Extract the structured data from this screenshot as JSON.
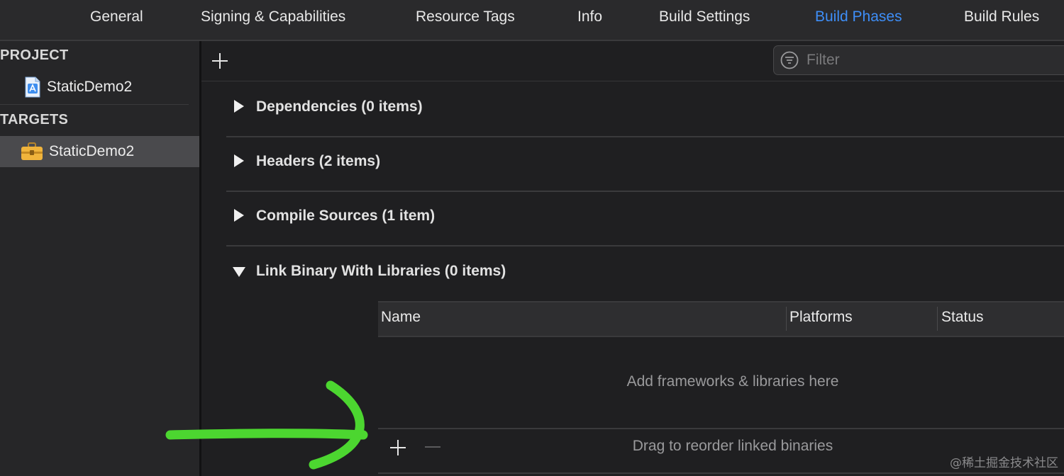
{
  "tabs": [
    "General",
    "Signing & Capabilities",
    "Resource Tags",
    "Info",
    "Build Settings",
    "Build Phases",
    "Build Rules"
  ],
  "active_tab": "Build Phases",
  "sidebar": {
    "project_title": "PROJECT",
    "project_item": "StaticDemo2",
    "targets_title": "TARGETS",
    "target_item": "StaticDemo2"
  },
  "filter": {
    "placeholder": "Filter"
  },
  "phases": [
    {
      "title": "Dependencies (0 items)",
      "expanded": false
    },
    {
      "title": "Headers (2 items)",
      "expanded": false
    },
    {
      "title": "Compile Sources (1 item)",
      "expanded": false
    },
    {
      "title": "Link Binary With Libraries (0 items)",
      "expanded": true
    }
  ],
  "library_table": {
    "columns": [
      "Name",
      "Platforms",
      "Status"
    ],
    "empty_hint": "Add frameworks & libraries here",
    "footer_hint": "Drag to reorder linked binaries"
  },
  "colors": {
    "accent": "#3e8ef7",
    "annotation_arrow": "#4cd630"
  },
  "icons": {
    "project": "xcode-project-icon",
    "target": "toolbox-icon",
    "filter": "filter-icon",
    "add": "plus-icon",
    "remove": "minus-icon"
  },
  "watermark": "@稀土掘金技术社区"
}
